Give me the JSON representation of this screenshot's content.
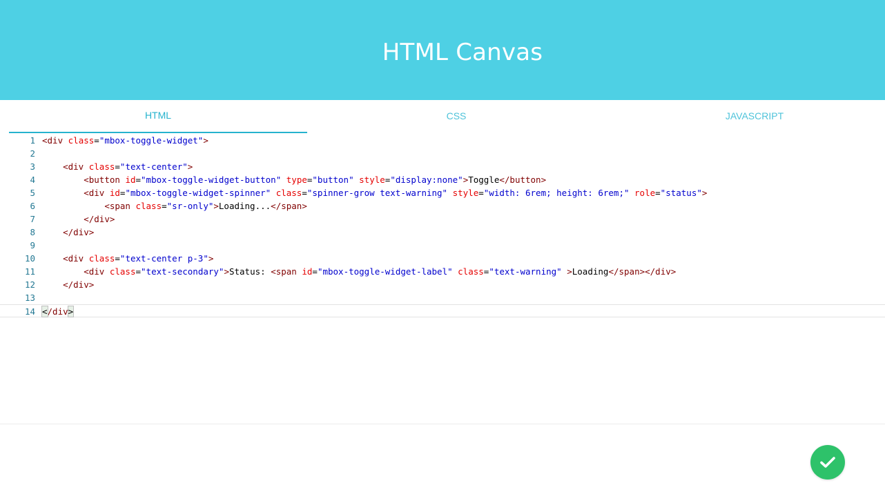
{
  "header": {
    "title": "HTML Canvas"
  },
  "tabs": [
    {
      "label": "HTML",
      "active": true
    },
    {
      "label": "CSS",
      "active": false
    },
    {
      "label": "JAVASCRIPT",
      "active": false
    }
  ],
  "editor": {
    "line_numbers": [
      "1",
      "2",
      "3",
      "4",
      "5",
      "6",
      "7",
      "8",
      "9",
      "10",
      "11",
      "12",
      "13",
      "14"
    ],
    "lines": [
      {
        "indent": "",
        "tokens": [
          [
            "tag",
            "<div "
          ],
          [
            "attr",
            "class"
          ],
          [
            "txt",
            "="
          ],
          [
            "str",
            "\"mbox-toggle-widget\""
          ],
          [
            "tag",
            ">"
          ]
        ]
      },
      {
        "indent": "",
        "tokens": []
      },
      {
        "indent": "    ",
        "tokens": [
          [
            "tag",
            "<div "
          ],
          [
            "attr",
            "class"
          ],
          [
            "txt",
            "="
          ],
          [
            "str",
            "\"text-center\""
          ],
          [
            "tag",
            ">"
          ]
        ]
      },
      {
        "indent": "        ",
        "tokens": [
          [
            "tag",
            "<button "
          ],
          [
            "attr",
            "id"
          ],
          [
            "txt",
            "="
          ],
          [
            "str",
            "\"mbox-toggle-widget-button\""
          ],
          [
            "txt",
            " "
          ],
          [
            "attr",
            "type"
          ],
          [
            "txt",
            "="
          ],
          [
            "str",
            "\"button\""
          ],
          [
            "txt",
            " "
          ],
          [
            "attr",
            "style"
          ],
          [
            "txt",
            "="
          ],
          [
            "str",
            "\"display:none\""
          ],
          [
            "tag",
            ">"
          ],
          [
            "txt",
            "Toggle"
          ],
          [
            "tag",
            "</button>"
          ]
        ]
      },
      {
        "indent": "        ",
        "tokens": [
          [
            "tag",
            "<div "
          ],
          [
            "attr",
            "id"
          ],
          [
            "txt",
            "="
          ],
          [
            "str",
            "\"mbox-toggle-widget-spinner\""
          ],
          [
            "txt",
            " "
          ],
          [
            "attr",
            "class"
          ],
          [
            "txt",
            "="
          ],
          [
            "str",
            "\"spinner-grow text-warning\""
          ],
          [
            "txt",
            " "
          ],
          [
            "attr",
            "style"
          ],
          [
            "txt",
            "="
          ],
          [
            "str",
            "\"width: 6rem; height: 6rem;\""
          ],
          [
            "txt",
            " "
          ],
          [
            "attr",
            "role"
          ],
          [
            "txt",
            "="
          ],
          [
            "str",
            "\"status\""
          ],
          [
            "tag",
            ">"
          ]
        ]
      },
      {
        "indent": "            ",
        "tokens": [
          [
            "tag",
            "<span "
          ],
          [
            "attr",
            "class"
          ],
          [
            "txt",
            "="
          ],
          [
            "str",
            "\"sr-only\""
          ],
          [
            "tag",
            ">"
          ],
          [
            "txt",
            "Loading..."
          ],
          [
            "tag",
            "</span>"
          ]
        ]
      },
      {
        "indent": "        ",
        "tokens": [
          [
            "tag",
            "</div>"
          ]
        ]
      },
      {
        "indent": "    ",
        "tokens": [
          [
            "tag",
            "</div>"
          ]
        ]
      },
      {
        "indent": "",
        "tokens": []
      },
      {
        "indent": "    ",
        "tokens": [
          [
            "tag",
            "<div "
          ],
          [
            "attr",
            "class"
          ],
          [
            "txt",
            "="
          ],
          [
            "str",
            "\"text-center p-3\""
          ],
          [
            "tag",
            ">"
          ]
        ]
      },
      {
        "indent": "        ",
        "tokens": [
          [
            "tag",
            "<div "
          ],
          [
            "attr",
            "class"
          ],
          [
            "txt",
            "="
          ],
          [
            "str",
            "\"text-secondary\""
          ],
          [
            "tag",
            ">"
          ],
          [
            "txt",
            "Status: "
          ],
          [
            "tag",
            "<span "
          ],
          [
            "attr",
            "id"
          ],
          [
            "txt",
            "="
          ],
          [
            "str",
            "\"mbox-toggle-widget-label\""
          ],
          [
            "txt",
            " "
          ],
          [
            "attr",
            "class"
          ],
          [
            "txt",
            "="
          ],
          [
            "str",
            "\"text-warning\""
          ],
          [
            "txt",
            " "
          ],
          [
            "tag",
            ">"
          ],
          [
            "txt",
            "Loading"
          ],
          [
            "tag",
            "</span></div>"
          ]
        ]
      },
      {
        "indent": "    ",
        "tokens": [
          [
            "tag",
            "</div>"
          ]
        ]
      },
      {
        "indent": "",
        "tokens": []
      },
      {
        "indent": "",
        "tokens": [
          [
            "caret",
            "<"
          ],
          [
            "tag",
            "/div"
          ],
          [
            "caret",
            ">"
          ]
        ]
      }
    ],
    "current_line": 14
  },
  "actions": {
    "confirm_icon": "check-icon"
  },
  "colors": {
    "header_bg": "#4ed0e4",
    "accent": "#26b3ce",
    "confirm": "#2ec26a"
  }
}
